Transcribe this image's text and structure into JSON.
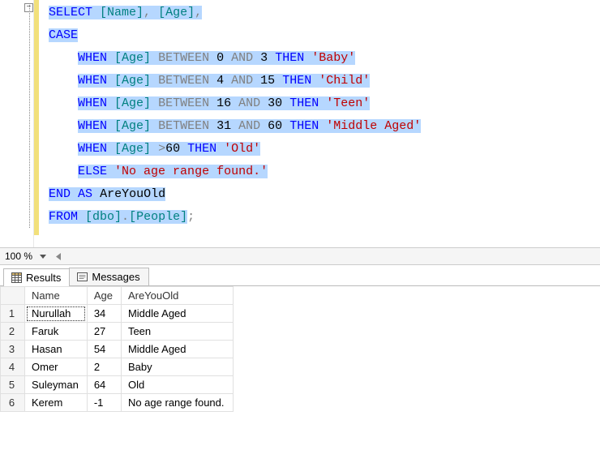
{
  "code": {
    "lines": [
      [
        {
          "t": "SELECT",
          "c": "kw",
          "hl": true
        },
        {
          "t": " ",
          "c": "plain",
          "hl": true
        },
        {
          "t": "[Name]",
          "c": "br",
          "hl": true
        },
        {
          "t": ",",
          "c": "gr",
          "hl": true
        },
        {
          "t": " ",
          "c": "plain",
          "hl": true
        },
        {
          "t": "[Age]",
          "c": "br",
          "hl": true
        },
        {
          "t": ",",
          "c": "gr",
          "hl": true
        }
      ],
      [
        {
          "t": "CASE",
          "c": "kw",
          "hl": true
        }
      ],
      [
        {
          "t": "    ",
          "c": "plain",
          "hl": false
        },
        {
          "t": "WHEN",
          "c": "kw",
          "hl": true
        },
        {
          "t": " ",
          "c": "plain",
          "hl": true
        },
        {
          "t": "[Age]",
          "c": "br",
          "hl": true
        },
        {
          "t": " ",
          "c": "plain",
          "hl": true
        },
        {
          "t": "BETWEEN",
          "c": "gr",
          "hl": true
        },
        {
          "t": " ",
          "c": "plain",
          "hl": true
        },
        {
          "t": "0",
          "c": "num",
          "hl": true
        },
        {
          "t": " ",
          "c": "plain",
          "hl": true
        },
        {
          "t": "AND",
          "c": "gr",
          "hl": true
        },
        {
          "t": " ",
          "c": "plain",
          "hl": true
        },
        {
          "t": "3",
          "c": "num",
          "hl": true
        },
        {
          "t": " ",
          "c": "plain",
          "hl": true
        },
        {
          "t": "THEN",
          "c": "kw",
          "hl": true
        },
        {
          "t": " ",
          "c": "plain",
          "hl": true
        },
        {
          "t": "'Baby'",
          "c": "str",
          "hl": true
        }
      ],
      [
        {
          "t": "    ",
          "c": "plain",
          "hl": false
        },
        {
          "t": "WHEN",
          "c": "kw",
          "hl": true
        },
        {
          "t": " ",
          "c": "plain",
          "hl": true
        },
        {
          "t": "[Age]",
          "c": "br",
          "hl": true
        },
        {
          "t": " ",
          "c": "plain",
          "hl": true
        },
        {
          "t": "BETWEEN",
          "c": "gr",
          "hl": true
        },
        {
          "t": " ",
          "c": "plain",
          "hl": true
        },
        {
          "t": "4",
          "c": "num",
          "hl": true
        },
        {
          "t": " ",
          "c": "plain",
          "hl": true
        },
        {
          "t": "AND",
          "c": "gr",
          "hl": true
        },
        {
          "t": " ",
          "c": "plain",
          "hl": true
        },
        {
          "t": "15",
          "c": "num",
          "hl": true
        },
        {
          "t": " ",
          "c": "plain",
          "hl": true
        },
        {
          "t": "THEN",
          "c": "kw",
          "hl": true
        },
        {
          "t": " ",
          "c": "plain",
          "hl": true
        },
        {
          "t": "'Child'",
          "c": "str",
          "hl": true
        }
      ],
      [
        {
          "t": "    ",
          "c": "plain",
          "hl": false
        },
        {
          "t": "WHEN",
          "c": "kw",
          "hl": true
        },
        {
          "t": " ",
          "c": "plain",
          "hl": true
        },
        {
          "t": "[Age]",
          "c": "br",
          "hl": true
        },
        {
          "t": " ",
          "c": "plain",
          "hl": true
        },
        {
          "t": "BETWEEN",
          "c": "gr",
          "hl": true
        },
        {
          "t": " ",
          "c": "plain",
          "hl": true
        },
        {
          "t": "16",
          "c": "num",
          "hl": true
        },
        {
          "t": " ",
          "c": "plain",
          "hl": true
        },
        {
          "t": "AND",
          "c": "gr",
          "hl": true
        },
        {
          "t": " ",
          "c": "plain",
          "hl": true
        },
        {
          "t": "30",
          "c": "num",
          "hl": true
        },
        {
          "t": " ",
          "c": "plain",
          "hl": true
        },
        {
          "t": "THEN",
          "c": "kw",
          "hl": true
        },
        {
          "t": " ",
          "c": "plain",
          "hl": true
        },
        {
          "t": "'Teen'",
          "c": "str",
          "hl": true
        }
      ],
      [
        {
          "t": "    ",
          "c": "plain",
          "hl": false
        },
        {
          "t": "WHEN",
          "c": "kw",
          "hl": true
        },
        {
          "t": " ",
          "c": "plain",
          "hl": true
        },
        {
          "t": "[Age]",
          "c": "br",
          "hl": true
        },
        {
          "t": " ",
          "c": "plain",
          "hl": true
        },
        {
          "t": "BETWEEN",
          "c": "gr",
          "hl": true
        },
        {
          "t": " ",
          "c": "plain",
          "hl": true
        },
        {
          "t": "31",
          "c": "num",
          "hl": true
        },
        {
          "t": " ",
          "c": "plain",
          "hl": true
        },
        {
          "t": "AND",
          "c": "gr",
          "hl": true
        },
        {
          "t": " ",
          "c": "plain",
          "hl": true
        },
        {
          "t": "60",
          "c": "num",
          "hl": true
        },
        {
          "t": " ",
          "c": "plain",
          "hl": true
        },
        {
          "t": "THEN",
          "c": "kw",
          "hl": true
        },
        {
          "t": " ",
          "c": "plain",
          "hl": true
        },
        {
          "t": "'Middle Aged'",
          "c": "str",
          "hl": true
        }
      ],
      [
        {
          "t": "    ",
          "c": "plain",
          "hl": false
        },
        {
          "t": "WHEN",
          "c": "kw",
          "hl": true
        },
        {
          "t": " ",
          "c": "plain",
          "hl": true
        },
        {
          "t": "[Age]",
          "c": "br",
          "hl": true
        },
        {
          "t": " ",
          "c": "plain",
          "hl": true
        },
        {
          "t": ">",
          "c": "gr",
          "hl": true
        },
        {
          "t": "60",
          "c": "num",
          "hl": true
        },
        {
          "t": " ",
          "c": "plain",
          "hl": true
        },
        {
          "t": "THEN",
          "c": "kw",
          "hl": true
        },
        {
          "t": " ",
          "c": "plain",
          "hl": true
        },
        {
          "t": "'Old'",
          "c": "str",
          "hl": true
        }
      ],
      [
        {
          "t": "    ",
          "c": "plain",
          "hl": false
        },
        {
          "t": "ELSE",
          "c": "kw",
          "hl": true
        },
        {
          "t": " ",
          "c": "plain",
          "hl": true
        },
        {
          "t": "'No age range found.'",
          "c": "str",
          "hl": true
        }
      ],
      [
        {
          "t": "END",
          "c": "kw",
          "hl": true
        },
        {
          "t": " ",
          "c": "plain",
          "hl": true
        },
        {
          "t": "AS",
          "c": "kw",
          "hl": true
        },
        {
          "t": " ",
          "c": "plain",
          "hl": true
        },
        {
          "t": "AreYouOld",
          "c": "plain",
          "hl": true
        }
      ],
      [
        {
          "t": "FROM",
          "c": "kw",
          "hl": true
        },
        {
          "t": " ",
          "c": "plain",
          "hl": true
        },
        {
          "t": "[dbo]",
          "c": "br",
          "hl": true
        },
        {
          "t": ".",
          "c": "gr",
          "hl": true
        },
        {
          "t": "[People]",
          "c": "br",
          "hl": true
        },
        {
          "t": ";",
          "c": "gr",
          "hl": false
        }
      ]
    ]
  },
  "zoom": {
    "value": "100 %"
  },
  "tabs": {
    "results": "Results",
    "messages": "Messages"
  },
  "grid": {
    "columns": [
      "Name",
      "Age",
      "AreYouOld"
    ],
    "rows": [
      {
        "n": "1",
        "Name": "Nurullah",
        "Age": "34",
        "AreYouOld": "Middle Aged"
      },
      {
        "n": "2",
        "Name": "Faruk",
        "Age": "27",
        "AreYouOld": "Teen"
      },
      {
        "n": "3",
        "Name": "Hasan",
        "Age": "54",
        "AreYouOld": "Middle Aged"
      },
      {
        "n": "4",
        "Name": "Omer",
        "Age": "2",
        "AreYouOld": "Baby"
      },
      {
        "n": "5",
        "Name": "Suleyman",
        "Age": "64",
        "AreYouOld": "Old"
      },
      {
        "n": "6",
        "Name": "Kerem",
        "Age": "-1",
        "AreYouOld": "No age range found."
      }
    ]
  }
}
